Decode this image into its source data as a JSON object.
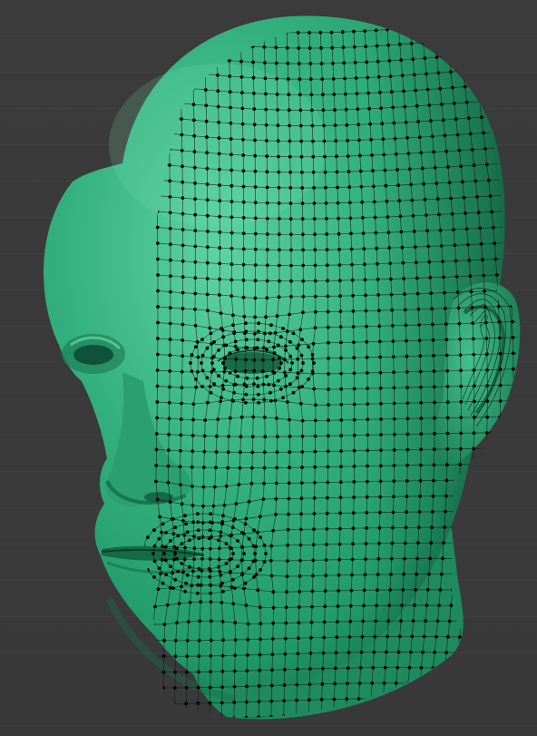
{
  "scene": {
    "description_label": "",
    "background_color": "#3a3a3a",
    "grid_line_color": "#444444",
    "mesh_color": "#2fa878",
    "mesh_highlight": "#5fd4a2",
    "mesh_shadow": "#146a48",
    "wire_color": "#0a1a12",
    "vertex_color": "#000000"
  }
}
